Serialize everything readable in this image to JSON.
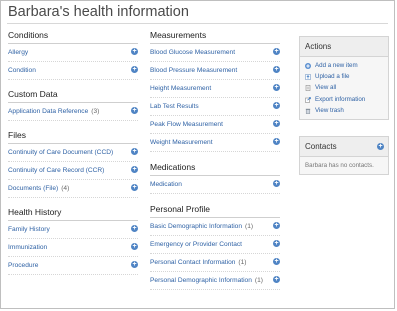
{
  "page": {
    "title": "Barbara's health information"
  },
  "left": {
    "sections": [
      {
        "key": "conditions",
        "header": "Conditions",
        "items": [
          {
            "label": "Allergy",
            "count": ""
          },
          {
            "label": "Condition",
            "count": ""
          }
        ]
      },
      {
        "key": "custom_data",
        "header": "Custom Data",
        "items": [
          {
            "label": "Application Data Reference",
            "count": "(3)"
          }
        ]
      },
      {
        "key": "files",
        "header": "Files",
        "items": [
          {
            "label": "Continuity of Care Document (CCD)",
            "count": ""
          },
          {
            "label": "Continuity of Care Record (CCR)",
            "count": ""
          },
          {
            "label": "Documents (File)",
            "count": "(4)"
          }
        ]
      },
      {
        "key": "health_history",
        "header": "Health History",
        "items": [
          {
            "label": "Family History",
            "count": ""
          },
          {
            "label": "Immunization",
            "count": ""
          },
          {
            "label": "Procedure",
            "count": ""
          }
        ]
      }
    ]
  },
  "middle": {
    "sections": [
      {
        "key": "measurements",
        "header": "Measurements",
        "items": [
          {
            "label": "Blood Glucose Measurement",
            "count": ""
          },
          {
            "label": "Blood Pressure Measurement",
            "count": ""
          },
          {
            "label": "Height Measurement",
            "count": ""
          },
          {
            "label": "Lab Test Results",
            "count": ""
          },
          {
            "label": "Peak Flow Measurement",
            "count": ""
          },
          {
            "label": "Weight Measurement",
            "count": ""
          }
        ]
      },
      {
        "key": "medications",
        "header": "Medications",
        "items": [
          {
            "label": "Medication",
            "count": ""
          }
        ]
      },
      {
        "key": "personal_profile",
        "header": "Personal Profile",
        "items": [
          {
            "label": "Basic Demographic Information",
            "count": "(1)"
          },
          {
            "label": "Emergency or Provider Contact",
            "count": ""
          },
          {
            "label": "Personal Contact Information",
            "count": "(1)"
          },
          {
            "label": "Personal Demographic Information",
            "count": "(1)"
          }
        ]
      }
    ]
  },
  "actions": {
    "header": "Actions",
    "items": [
      {
        "label": "Add a new item",
        "icon": "add-item-icon"
      },
      {
        "label": "Upload a file",
        "icon": "upload-icon"
      },
      {
        "label": "View all",
        "icon": "view-all-icon"
      },
      {
        "label": "Export information",
        "icon": "export-icon"
      },
      {
        "label": "View trash",
        "icon": "trash-icon"
      }
    ]
  },
  "contacts": {
    "header": "Contacts",
    "empty_text": "Barbara has no contacts."
  },
  "colors": {
    "link": "#2f62a5",
    "plus_icon": "#4f84c4",
    "panel_bg": "#eeeeee"
  }
}
